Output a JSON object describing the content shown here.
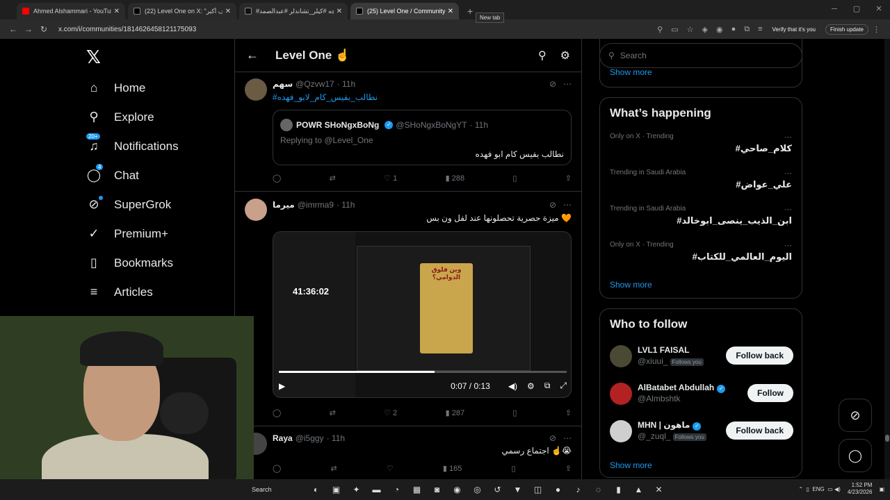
{
  "browser": {
    "tabs": [
      {
        "label": "Ahmed Alshammari - YouTube",
        "color": "#ff0000",
        "active": false
      },
      {
        "label": "(22) Level One on X: \"يهدف أكبر",
        "color": "#ffffff",
        "active": false
      },
      {
        "label": "#مجه #كيلر_تشاندلر #عبدالصمد",
        "color": "#ffffff",
        "active": false
      },
      {
        "label": "(25) Level One / Community / X",
        "color": "#ffffff",
        "active": true
      }
    ],
    "new_tab_tooltip": "New tab",
    "url": "x.com/i/communities/1814626458121175093",
    "verify_label": "Verify that it's you",
    "finish_update": "Finish update"
  },
  "nav": {
    "items": [
      {
        "label": "Home",
        "icon": "home-icon",
        "glyph": "⌂"
      },
      {
        "label": "Explore",
        "icon": "search-icon",
        "glyph": "⚲"
      },
      {
        "label": "Notifications",
        "icon": "bell-icon",
        "glyph": "♪",
        "badge": "20+"
      },
      {
        "label": "Chat",
        "icon": "chat-icon",
        "glyph": "◯",
        "badge": "4"
      },
      {
        "label": "SuperGrok",
        "icon": "grok-icon",
        "glyph": "⊘"
      },
      {
        "label": "Premium+",
        "icon": "premium-icon",
        "glyph": "✓"
      },
      {
        "label": "Bookmarks",
        "icon": "bookmark-icon",
        "glyph": "▯"
      },
      {
        "label": "Articles",
        "icon": "articles-icon",
        "glyph": "≡"
      }
    ]
  },
  "main": {
    "title": "Level One ☝️",
    "posts": [
      {
        "name": "سهم",
        "handle": "@Qzvw17",
        "time": "· 11h",
        "link": "#نطالب_بفيس_كام_لابو_فهده",
        "quote": {
          "name": "POWR SHoNgxBoNg",
          "handle": "@SHoNgxBoNgYT",
          "time": "· 11h",
          "reply": "Replying to @Level_One",
          "text": "نطالب بفيس كام ابو فهده"
        },
        "likes": "1",
        "views": "288"
      },
      {
        "name": "ميرما",
        "handle": "@imrma9",
        "time": "· 11h",
        "text": "ميزة حصرية تحصلونها عند لفل ون بس 🧡",
        "video": {
          "overlay_timer": "41:36:02",
          "time": "0:07 / 0:13",
          "poster_title": "وين فلوق الدوامي؟",
          "progress": 0.54
        },
        "likes": "2",
        "views": "287"
      },
      {
        "name": "Raya",
        "handle": "@i5ggy",
        "time": "· 11h",
        "text": "اجتماع رسمي ☝️😭",
        "likes": "",
        "views": "165"
      }
    ]
  },
  "right": {
    "search_placeholder": "Search",
    "show_more": "Show more",
    "whats_happening": {
      "title": "What’s happening",
      "trends": [
        {
          "meta": "Only on X · Trending",
          "name": "#كلام_صاحي"
        },
        {
          "meta": "Trending in Saudi Arabia",
          "name": "#علي_عواض"
        },
        {
          "meta": "Trending in Saudi Arabia",
          "name": "#ابن_الذيب_ينصى_ابوخالد"
        },
        {
          "meta": "Only on X · Trending",
          "name": "#اليوم_العالمي_للكتاب"
        }
      ]
    },
    "who_to_follow": {
      "title": "Who to follow",
      "users": [
        {
          "name": "LVL1 FAISAL",
          "handle": "@xiuui_",
          "follows_you": "Follows you",
          "button": "Follow back",
          "color": "#3a3a2a"
        },
        {
          "name": "AlBatabet Abdullah",
          "handle": "@Almbshtk",
          "follows_you": "",
          "button": "Follow",
          "color": "#b22222"
        },
        {
          "name": "MHN | ماهون",
          "handle": "@_zuql_",
          "follows_you": "Follows you",
          "button": "Follow back",
          "color": "#dddddd"
        }
      ]
    }
  },
  "taskbar": {
    "search_label": "Search",
    "lang": "ENG",
    "time": "1:52 PM",
    "date": "4/23/2026"
  }
}
